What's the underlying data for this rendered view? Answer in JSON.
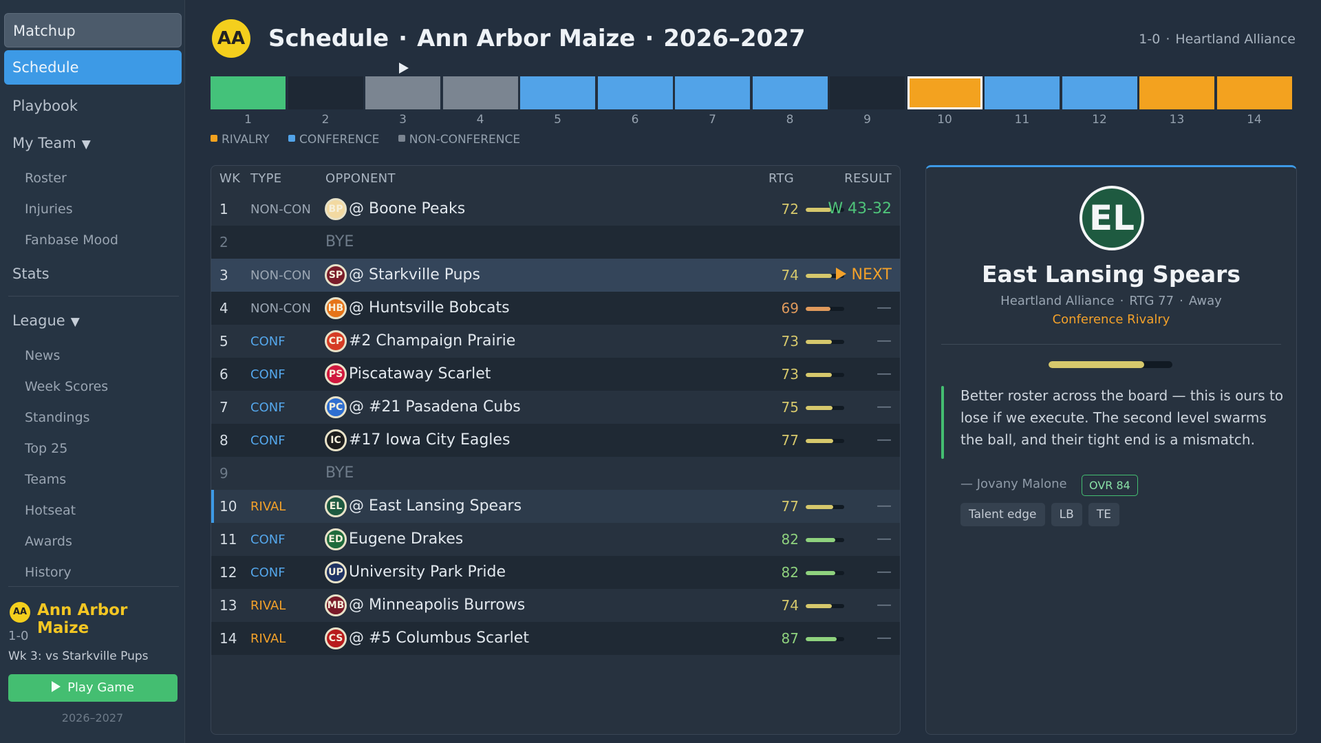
{
  "sidebar": {
    "top_items": [
      {
        "label": "Matchup"
      },
      {
        "label": "Schedule"
      }
    ],
    "items": [
      {
        "label": "Playbook"
      },
      {
        "label": "My Team"
      },
      {
        "label": "Roster"
      },
      {
        "label": "Injuries"
      },
      {
        "label": "Fanbase Mood"
      },
      {
        "label": "Stats"
      },
      {
        "label": "League"
      },
      {
        "label": "News"
      },
      {
        "label": "Week Scores"
      },
      {
        "label": "Standings"
      },
      {
        "label": "Top 25"
      },
      {
        "label": "Teams"
      },
      {
        "label": "Hotseat"
      },
      {
        "label": "Awards"
      },
      {
        "label": "History"
      }
    ],
    "team": {
      "abbr": "AA",
      "name": "Ann Arbor Maize",
      "record": "1-0",
      "next_game": "Wk 3: vs Starkville Pups",
      "play_label": "Play Game",
      "season": "2026–2027"
    }
  },
  "header": {
    "logo_abbr": "AA",
    "title_parts": [
      "Schedule",
      "Ann Arbor Maize",
      "2026–2027"
    ],
    "dot": "·",
    "record": "1-0",
    "conference": "Heartland Alliance"
  },
  "strip": {
    "current_week": 3,
    "weeks": [
      {
        "num": "1",
        "kind": "win"
      },
      {
        "num": "2",
        "kind": "bye"
      },
      {
        "num": "3",
        "kind": "nonconf"
      },
      {
        "num": "4",
        "kind": "nonconf"
      },
      {
        "num": "5",
        "kind": "conf"
      },
      {
        "num": "6",
        "kind": "conf"
      },
      {
        "num": "7",
        "kind": "conf"
      },
      {
        "num": "8",
        "kind": "conf"
      },
      {
        "num": "9",
        "kind": "bye"
      },
      {
        "num": "10",
        "kind": "rival_selected"
      },
      {
        "num": "11",
        "kind": "conf"
      },
      {
        "num": "12",
        "kind": "conf"
      },
      {
        "num": "13",
        "kind": "rival"
      },
      {
        "num": "14",
        "kind": "rival"
      }
    ],
    "colors": {
      "win": "#44c27a",
      "conf": "#52a3e8",
      "nonconf": "#7b8591",
      "rival": "#f3a21f",
      "bye": "#1e2834"
    },
    "legend": [
      {
        "label": "RIVALRY",
        "color": "#f3a21f"
      },
      {
        "label": "CONFERENCE",
        "color": "#52a3e8"
      },
      {
        "label": "NON-CONFERENCE",
        "color": "#7b8591"
      }
    ]
  },
  "table": {
    "headers": {
      "wk": "WK",
      "type": "TYPE",
      "opponent": "OPPONENT",
      "rtg": "RTG",
      "result": "RESULT"
    },
    "rows": [
      {
        "wk": "1",
        "type": "NON-CON",
        "abbr": "BP",
        "logo": "#f2d9a1",
        "opponent": "@ Boone Peaks",
        "rtg": "72",
        "rtg_pct": 0.72,
        "rtg_color": "#d6c86c",
        "result": "W 43-32",
        "state": "win"
      },
      {
        "wk": "2",
        "type": "",
        "bye": "BYE",
        "state": "bye"
      },
      {
        "wk": "3",
        "type": "NON-CON",
        "abbr": "SP",
        "logo": "#7a1d2a",
        "opponent": "@ Starkville Pups",
        "rtg": "74",
        "rtg_pct": 0.74,
        "rtg_color": "#d6c86c",
        "result": "NEXT",
        "state": "next"
      },
      {
        "wk": "4",
        "type": "NON-CON",
        "abbr": "HB",
        "logo": "#e67418",
        "opponent": "@ Huntsville Bobcats",
        "rtg": "69",
        "rtg_pct": 0.69,
        "rtg_color": "#e09a5c",
        "result": "—",
        "state": ""
      },
      {
        "wk": "5",
        "type": "CONF",
        "abbr": "CP",
        "logo": "#d63c24",
        "opponent": "#2 Champaign Prairie",
        "rtg": "73",
        "rtg_pct": 0.73,
        "rtg_color": "#d6c86c",
        "result": "—",
        "state": ""
      },
      {
        "wk": "6",
        "type": "CONF",
        "abbr": "PS",
        "logo": "#d0183d",
        "opponent": "Piscataway Scarlet",
        "rtg": "73",
        "rtg_pct": 0.73,
        "rtg_color": "#d6c86c",
        "result": "—",
        "state": ""
      },
      {
        "wk": "7",
        "type": "CONF",
        "abbr": "PC",
        "logo": "#2f6fd0",
        "opponent": "@ #21 Pasadena Cubs",
        "rtg": "75",
        "rtg_pct": 0.75,
        "rtg_color": "#d6c86c",
        "result": "—",
        "state": ""
      },
      {
        "wk": "8",
        "type": "CONF",
        "abbr": "IC",
        "logo": "#1d1d1d",
        "opponent": "#17 Iowa City Eagles",
        "rtg": "77",
        "rtg_pct": 0.77,
        "rtg_color": "#d6c86c",
        "result": "—",
        "state": ""
      },
      {
        "wk": "9",
        "type": "",
        "bye": "BYE",
        "state": "bye"
      },
      {
        "wk": "10",
        "type": "RIVAL",
        "abbr": "EL",
        "logo": "#1e5a40",
        "opponent": "@ East Lansing Spears",
        "rtg": "77",
        "rtg_pct": 0.77,
        "rtg_color": "#d6c86c",
        "result": "—",
        "state": "sel"
      },
      {
        "wk": "11",
        "type": "CONF",
        "abbr": "ED",
        "logo": "#1f6b3b",
        "opponent": "Eugene Drakes",
        "rtg": "82",
        "rtg_pct": 0.82,
        "rtg_color": "#8fd27e",
        "result": "—",
        "state": ""
      },
      {
        "wk": "12",
        "type": "CONF",
        "abbr": "UP",
        "logo": "#1f3364",
        "opponent": "University Park Pride",
        "rtg": "82",
        "rtg_pct": 0.82,
        "rtg_color": "#8fd27e",
        "result": "—",
        "state": ""
      },
      {
        "wk": "13",
        "type": "RIVAL",
        "abbr": "MB",
        "logo": "#7a1a28",
        "opponent": "@ Minneapolis Burrows",
        "rtg": "74",
        "rtg_pct": 0.74,
        "rtg_color": "#d6c86c",
        "result": "—",
        "state": ""
      },
      {
        "wk": "14",
        "type": "RIVAL",
        "abbr": "CS",
        "logo": "#b81c1c",
        "opponent": "@ #5 Columbus Scarlet",
        "rtg": "87",
        "rtg_pct": 0.87,
        "rtg_color": "#8fd27e",
        "result": "—",
        "state": ""
      }
    ]
  },
  "detail": {
    "abbr": "EL",
    "name": "East Lansing Spears",
    "conference": "Heartland Alliance",
    "rtg": "RTG 77",
    "location": "Away",
    "tag": "Conference Rivalry",
    "rtg_pct": 0.77,
    "quote": "Better roster across the board — this is ours to lose if we execute. The second level swarms the ball, and their tight end is a mismatch.",
    "author": "— Jovany Malone",
    "ovr": "OVR 84",
    "tags": [
      "Talent edge",
      "LB",
      "TE"
    ]
  }
}
